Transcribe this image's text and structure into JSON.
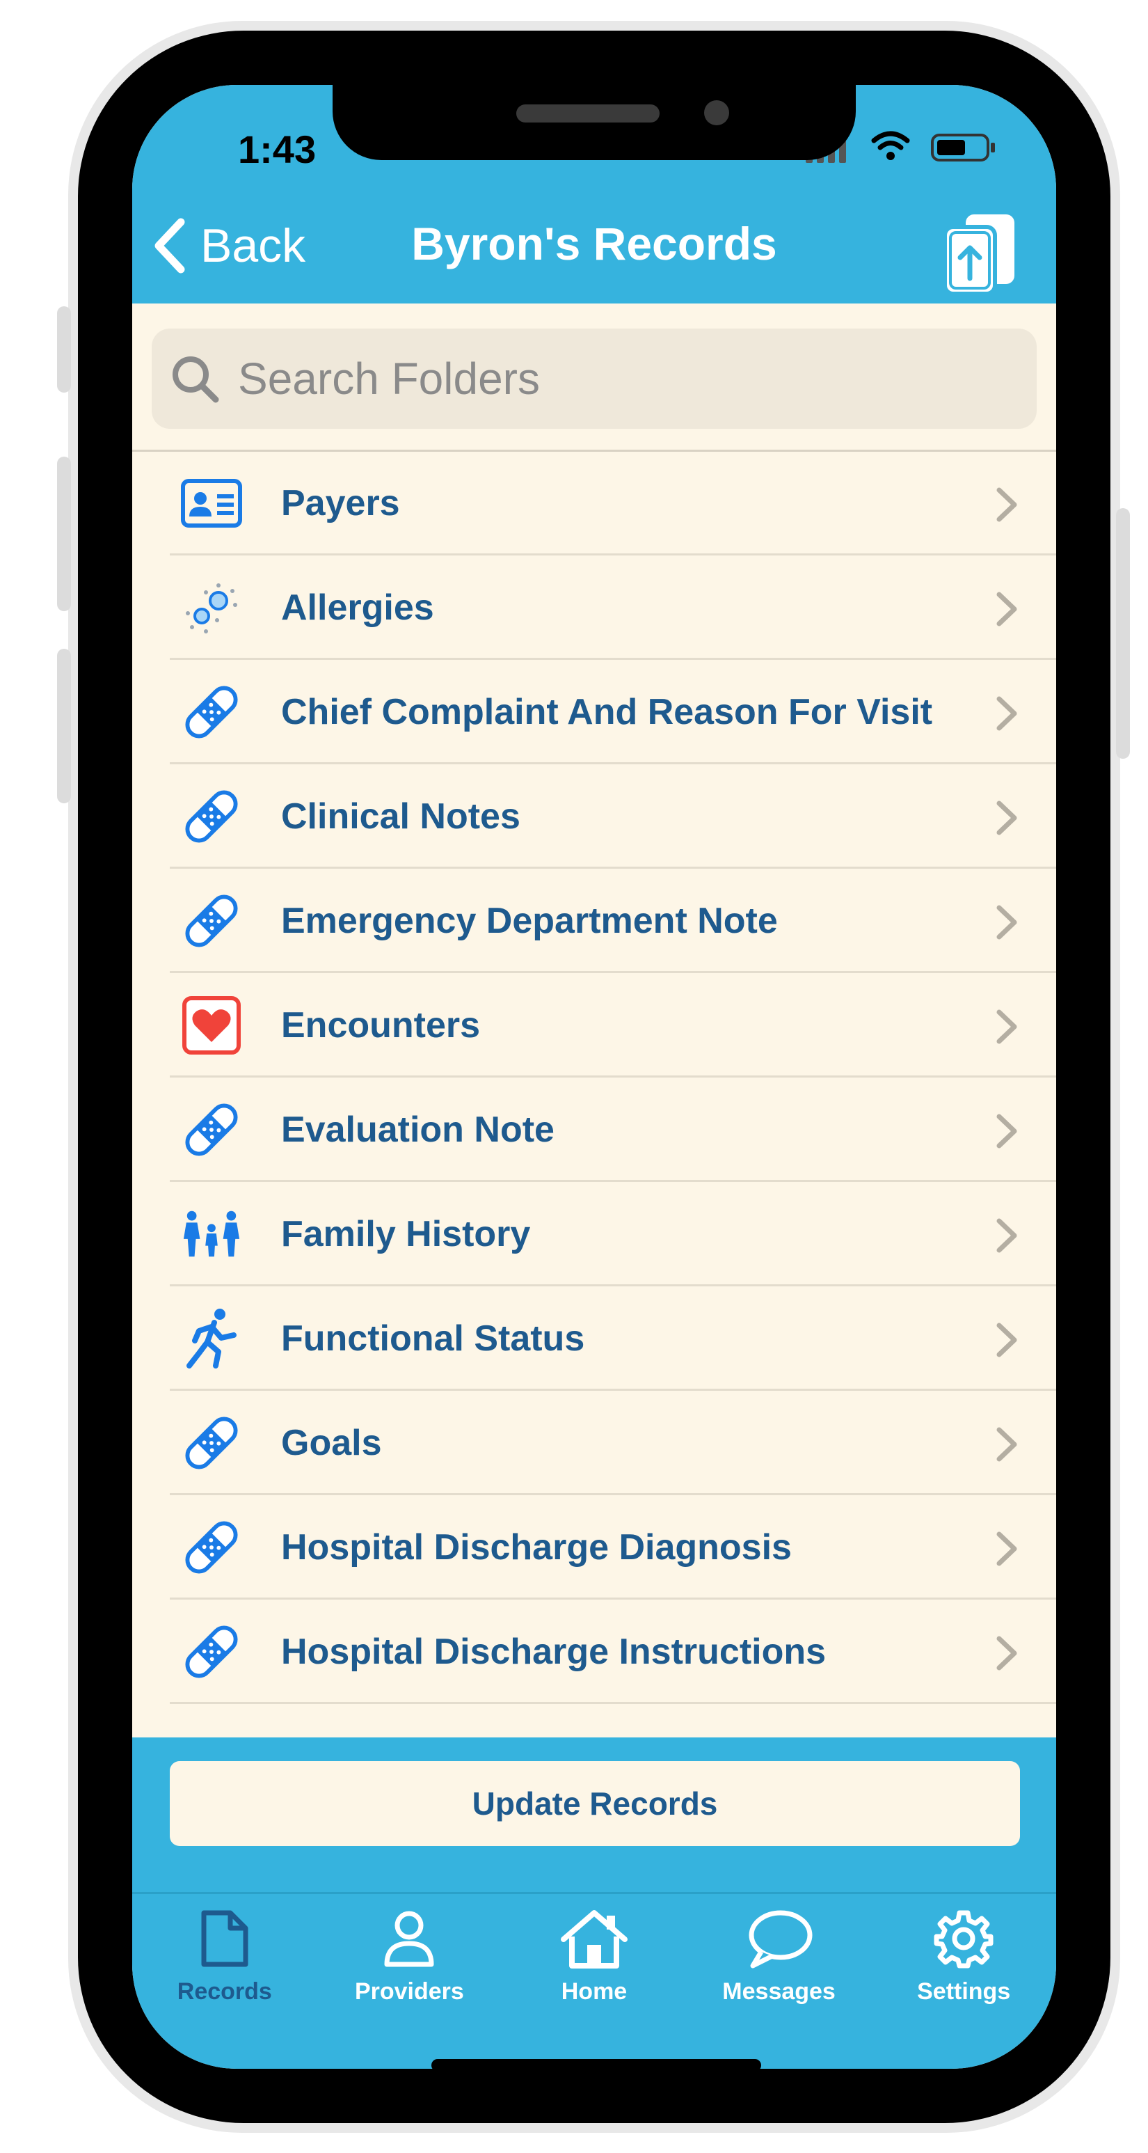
{
  "status_bar": {
    "time": "1:43"
  },
  "nav": {
    "back_label": "Back",
    "title": "Byron's Records"
  },
  "search": {
    "placeholder": "Search Folders"
  },
  "folders": [
    {
      "label": "Payers",
      "icon": "id-card-icon"
    },
    {
      "label": "Allergies",
      "icon": "allergen-icon"
    },
    {
      "label": "Chief Complaint And Reason For Visit",
      "icon": "bandage-icon"
    },
    {
      "label": "Clinical Notes",
      "icon": "bandage-icon"
    },
    {
      "label": "Emergency Department Note",
      "icon": "bandage-icon"
    },
    {
      "label": "Encounters",
      "icon": "heart-icon"
    },
    {
      "label": "Evaluation Note",
      "icon": "bandage-icon"
    },
    {
      "label": "Family History",
      "icon": "family-icon"
    },
    {
      "label": "Functional Status",
      "icon": "runner-icon"
    },
    {
      "label": "Goals",
      "icon": "bandage-icon"
    },
    {
      "label": "Hospital Discharge Diagnosis",
      "icon": "bandage-icon"
    },
    {
      "label": "Hospital Discharge Instructions",
      "icon": "bandage-icon"
    }
  ],
  "actions": {
    "update_label": "Update Records"
  },
  "tabs": [
    {
      "label": "Records",
      "icon": "document-icon",
      "active": true
    },
    {
      "label": "Providers",
      "icon": "person-icon",
      "active": false
    },
    {
      "label": "Home",
      "icon": "house-icon",
      "active": false
    },
    {
      "label": "Messages",
      "icon": "chat-bubble-icon",
      "active": false
    },
    {
      "label": "Settings",
      "icon": "gear-icon",
      "active": false
    }
  ],
  "colors": {
    "header": "#36b3de",
    "background": "#fdf6e7",
    "text": "#1e5a8e",
    "icon_blue": "#1a7be6",
    "icon_red": "#f0433a"
  }
}
